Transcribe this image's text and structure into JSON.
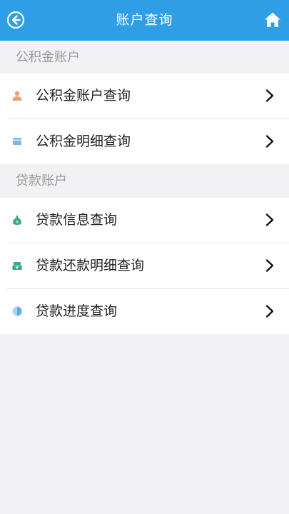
{
  "header": {
    "title": "账户查询",
    "back_icon": "back-arrow-circle-icon",
    "home_icon": "home-icon"
  },
  "sections": [
    {
      "title": "公积金账户",
      "items": [
        {
          "label": "公积金账户查询",
          "icon": "person-icon",
          "icon_color": "#e8a07a"
        },
        {
          "label": "公积金明细查询",
          "icon": "card-icon",
          "icon_color": "#7ab8e8"
        }
      ]
    },
    {
      "title": "贷款账户",
      "items": [
        {
          "label": "贷款信息查询",
          "icon": "money-bag-icon",
          "icon_color": "#3aa88c"
        },
        {
          "label": "贷款还款明细查询",
          "icon": "cash-icon",
          "icon_color": "#3aa88c"
        },
        {
          "label": "贷款进度查询",
          "icon": "progress-pie-icon",
          "icon_color": "#5aaee0"
        }
      ]
    }
  ],
  "colors": {
    "header_bg": "#2e9ee6",
    "page_bg": "#f2f2f4",
    "section_title": "#9a9a9a"
  }
}
